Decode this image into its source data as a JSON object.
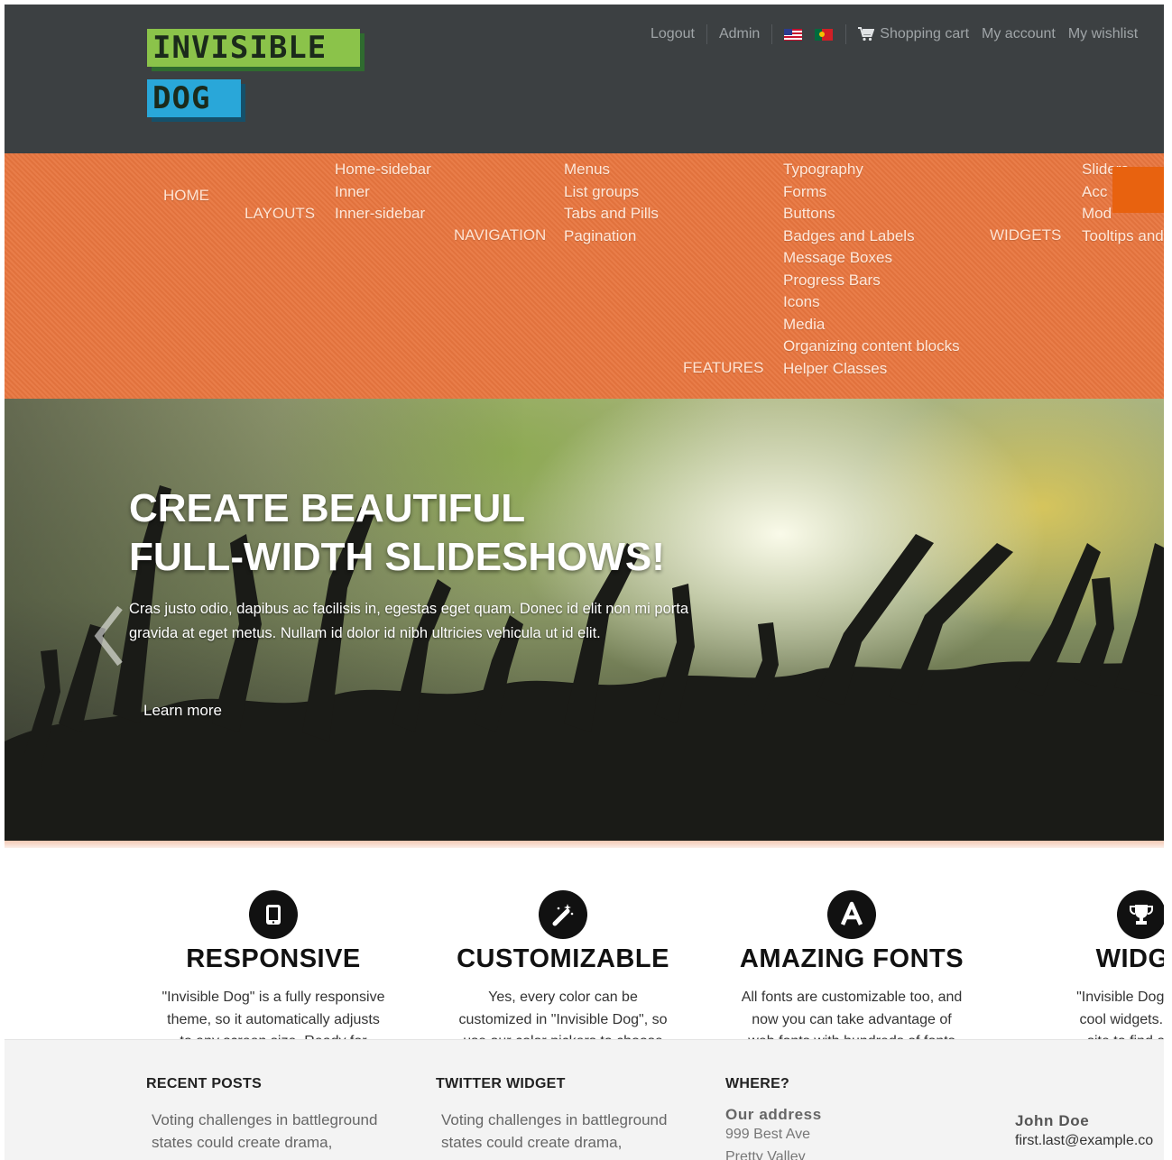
{
  "logo": {
    "line1": "INVISIBLE",
    "line2": "DOG"
  },
  "header": {
    "links_left": [
      "Logout",
      "Admin"
    ],
    "flags": [
      "us-flag-icon",
      "pt-flag-icon"
    ],
    "cart_label": "Shopping cart",
    "links_right": [
      "My account",
      "My wishlist"
    ]
  },
  "nav": {
    "home": "HOME",
    "layouts": {
      "label": "LAYOUTS",
      "items": [
        "Home-sidebar",
        "Inner",
        "Inner-sidebar"
      ]
    },
    "navigation": {
      "label": "NAVIGATION",
      "items": [
        "Menus",
        "List groups",
        "Tabs and Pills",
        "Pagination"
      ]
    },
    "features": {
      "label": "FEATURES",
      "items": [
        "Typography",
        "Forms",
        "Buttons",
        "Badges and Labels",
        "Message Boxes",
        "Progress Bars",
        "Icons",
        "Media",
        "Organizing content blocks",
        "Helper Classes"
      ]
    },
    "widgets": {
      "label": "WIDGETS",
      "items": [
        "Sliders",
        "Acc",
        "Mod",
        "Tooltips and"
      ]
    }
  },
  "hero": {
    "title_line1": "CREATE BEAUTIFUL",
    "title_line2": "FULL-WIDTH SLIDESHOWS!",
    "text": "Cras justo odio, dapibus ac facilisis in, egestas eget quam. Donec id elit non mi porta gravida at eget metus. Nullam id dolor id nibh ultricies vehicula ut id elit.",
    "button": "Learn more"
  },
  "features": [
    {
      "icon": "tablet-icon",
      "title": "RESPONSIVE",
      "text": "\"Invisible Dog\" is a fully responsive\ntheme, so it automatically adjusts\nto any screen size. Ready for"
    },
    {
      "icon": "magic-wand-icon",
      "title": "CUSTOMIZABLE",
      "text": "Yes, every color can be\ncustomized in \"Invisible Dog\", so\nuse our color pickers to choose"
    },
    {
      "icon": "font-icon",
      "title": "AMAZING FONTS",
      "text": "All fonts are customizable too, and\nnow you can take advantage of\nweb fonts with hundreds of fonts"
    },
    {
      "icon": "trophy-icon",
      "title": "WIDGE",
      "text": "\"Invisible Dog\" is als\ncool widgets. Explo\nsite to find all the"
    }
  ],
  "footer": {
    "recent_posts": {
      "heading": "RECENT POSTS",
      "post": "Voting challenges in battleground\nstates could create drama,"
    },
    "twitter": {
      "heading": "TWITTER WIDGET",
      "post": "Voting challenges in battleground\nstates could create drama,"
    },
    "where": {
      "heading": "WHERE?",
      "address_label": "Our address",
      "street": "999 Best Ave",
      "city": "Pretty Valley"
    },
    "contact": {
      "name": "John Doe",
      "email": "first.last@example.co"
    }
  },
  "colors": {
    "header_bg": "#3c4042",
    "nav_bg": "#e8763f",
    "logo_green": "#8bc34a",
    "logo_blue": "#29a7d9",
    "footer_bg": "#f3f3f3"
  }
}
